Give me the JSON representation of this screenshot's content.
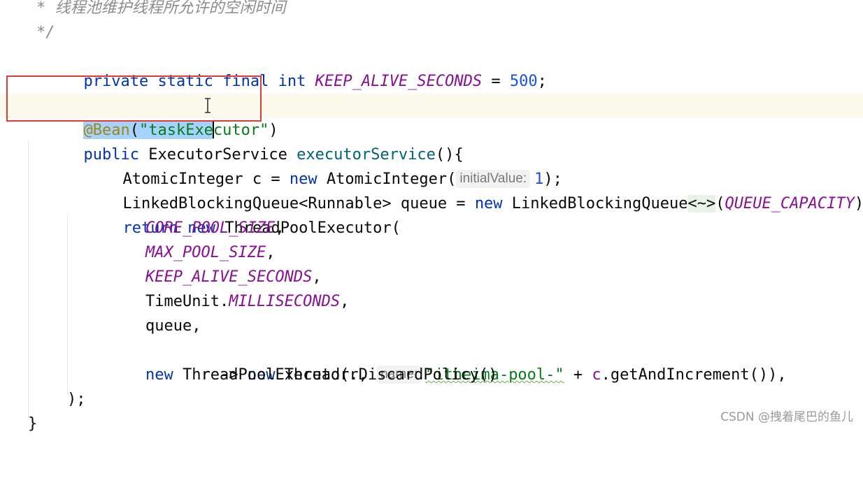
{
  "lines": [
    {
      "comment_star": "*",
      "comment_text": "线程池维护线程所允许的空闲时间"
    },
    {
      "comment_end": "*/"
    },
    {
      "kw1": "private",
      "kw2": "static",
      "kw3": "final",
      "kw4": "int",
      "const": "KEEP_ALIVE_SECONDS",
      "op": " = ",
      "num": "500",
      "end": ";"
    },
    {},
    {
      "annotation": "@Bean",
      "paren_open": "(",
      "str_sel_part": "\"taskExe",
      "str_rest": "cutor\"",
      "paren_close": ")"
    },
    {
      "kw1": "public",
      "type": "ExecutorService",
      "method": "executorService",
      "rest": "(){"
    },
    {
      "type": "AtomicInteger",
      "var": " c = ",
      "kw": "new",
      "ctor": " AtomicInteger(",
      "hint": "initialValue:",
      "num": "1",
      "end": ");"
    },
    {
      "type": "LinkedBlockingQueue<Runnable> queue = ",
      "kw": "new",
      "ctor": " LinkedBlockingQueue",
      "diamond": "<~>",
      "paren": "(",
      "const": "QUEUE_CAPACITY",
      "end": ");"
    },
    {
      "kw1": "return",
      "kw2": "new",
      "ctor": "ThreadPoolExecutor("
    },
    {
      "const": "CORE_POOL_SIZE",
      "end": ","
    },
    {
      "const": "MAX_POOL_SIZE",
      "end": ","
    },
    {
      "const": "KEEP_ALIVE_SECONDS",
      "end": ","
    },
    {
      "type": "TimeUnit.",
      "const": "MILLISECONDS",
      "end": ","
    },
    {
      "text": "queue,"
    },
    {
      "pre": "r -> ",
      "kw": "new",
      "ctor": " Thread(r, ",
      "hint": "name:",
      "str": "\"itheima-pool-\"",
      "plus": " + ",
      "field": "c",
      "call": ".getAndIncrement()),"
    },
    {
      "kw": "new",
      "rest": " ThreadPoolExecutor.DiscardPolicy()"
    },
    {
      "text": ");"
    },
    {
      "text": "}"
    }
  ],
  "watermark": "CSDN @拽着尾巴的鱼儿",
  "colors": {
    "keyword": "#0033b3",
    "constant": "#871094",
    "number": "#1750eb",
    "string": "#067d17",
    "annotation": "#9e880d",
    "comment": "#8c8c8c",
    "selection": "#a6d2ff",
    "highlight_box": "#e53935"
  }
}
